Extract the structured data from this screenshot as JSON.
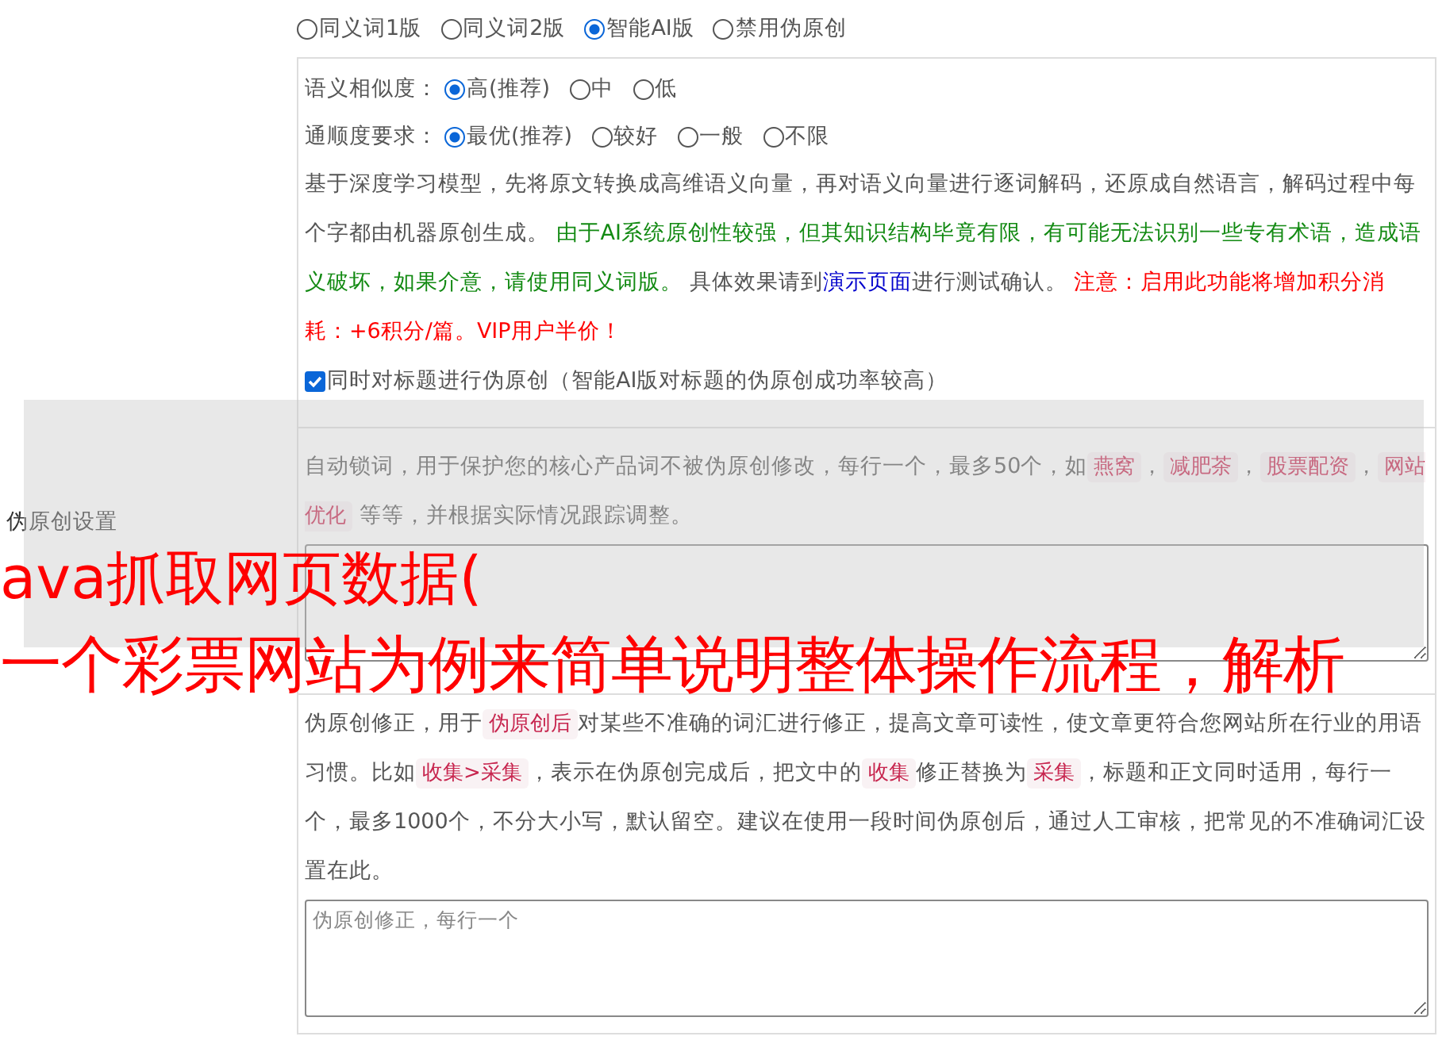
{
  "sidebar_label": "伪原创设置",
  "mode_options": [
    {
      "label": "同义词1版",
      "selected": false
    },
    {
      "label": "同义词2版",
      "selected": false
    },
    {
      "label": "智能AI版",
      "selected": true
    },
    {
      "label": "禁用伪原创",
      "selected": false
    }
  ],
  "similarity": {
    "label": "语义相似度：",
    "options": [
      {
        "label": "高(推荐)",
        "selected": true
      },
      {
        "label": "中",
        "selected": false
      },
      {
        "label": "低",
        "selected": false
      }
    ]
  },
  "fluency": {
    "label": "通顺度要求：",
    "options": [
      {
        "label": "最优(推荐)",
        "selected": true
      },
      {
        "label": "较好",
        "selected": false
      },
      {
        "label": "一般",
        "selected": false
      },
      {
        "label": "不限",
        "selected": false
      }
    ]
  },
  "ai_description": [
    {
      "kind": "plain",
      "text": "基于深度学习模型，先将原文转换成高维语义向量，再对语义向量进行逐词解码，还原成自然语言，解码过程中每个字都由机器原创生成。 "
    },
    {
      "kind": "notice",
      "text": "由于AI系统原创性较强，但其知识结构毕竟有限，有可能无法识别一些专有术语，造成语义破坏，如果介意，请使用同义词版。"
    },
    {
      "kind": "plain",
      "text": " 具体效果请到"
    },
    {
      "kind": "link",
      "text": "演示页面"
    },
    {
      "kind": "plain",
      "text": "进行测试确认。 "
    },
    {
      "kind": "warning",
      "text": "注意：启用此功能将增加积分消耗：+6积分/篇。VIP用户半价！"
    }
  ],
  "title_option": {
    "label": "同时对标题进行伪原创（智能AI版对标题的伪原创成功率较高）",
    "checked": true
  },
  "lock_words": {
    "description": [
      {
        "kind": "plain",
        "text": "自动锁词，用于保护您的核心产品词不被伪原创修改，每行一个，最多50个，如"
      },
      {
        "kind": "code",
        "text": "燕窝"
      },
      {
        "kind": "plain",
        "text": "，"
      },
      {
        "kind": "code",
        "text": "减肥茶"
      },
      {
        "kind": "plain",
        "text": "，"
      },
      {
        "kind": "code",
        "text": "股票配资"
      },
      {
        "kind": "plain",
        "text": "，"
      },
      {
        "kind": "code",
        "text": "网站优化"
      },
      {
        "kind": "plain",
        "text": " 等等，并根据实际情况跟踪调整。"
      }
    ]
  },
  "corrections": {
    "description": [
      {
        "kind": "plain",
        "text": "伪原创修正，用于"
      },
      {
        "kind": "code",
        "text": "伪原创后"
      },
      {
        "kind": "plain",
        "text": "对某些不准确的词汇进行修正，提高文章可读性，使文章更符合您网站所在行业的用语习惯。比如"
      },
      {
        "kind": "code",
        "text": "收集>采集"
      },
      {
        "kind": "plain",
        "text": "，表示在伪原创完成后，把文中的"
      },
      {
        "kind": "code",
        "text": "收集"
      },
      {
        "kind": "plain",
        "text": "修正替换为"
      },
      {
        "kind": "code",
        "text": "采集"
      },
      {
        "kind": "plain",
        "text": "，标题和正文同时适用，每行一个，最多1000个，不分大小写，默认留空。建议在使用一段时间伪原创后，通过人工审核，把常见的不准确词汇设置在此。"
      }
    ],
    "placeholder": "伪原创修正，每行一个"
  },
  "overlay_banner": {
    "lines": [
      "ava抓取网页数据(",
      "一个彩票网站为例来简单说明整体操作流程，解析"
    ]
  }
}
